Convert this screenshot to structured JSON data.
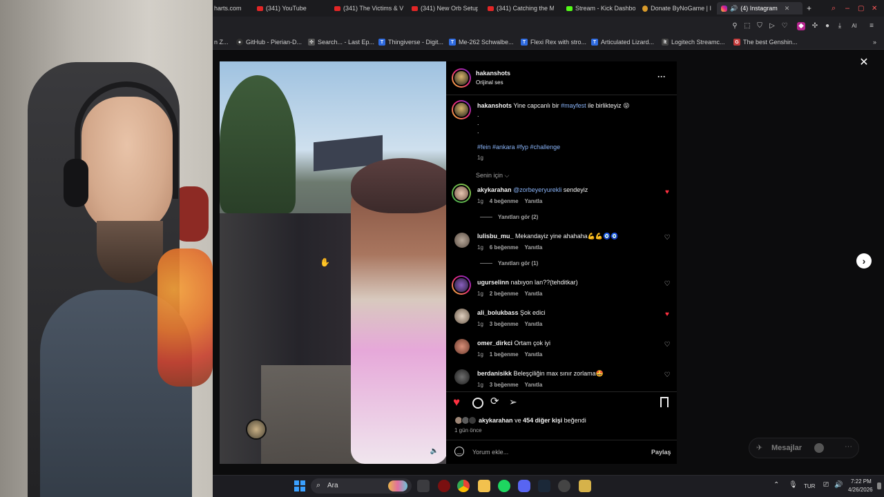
{
  "browser": {
    "tabs": [
      {
        "label": "harts.com",
        "icon": "none"
      },
      {
        "label": "(341) YouTube",
        "icon": "youtube"
      },
      {
        "label": "(341) The Victims & V",
        "icon": "youtube"
      },
      {
        "label": "(341) New Orb Setup!",
        "icon": "youtube"
      },
      {
        "label": "(341) Catching the M",
        "icon": "youtube"
      },
      {
        "label": "Stream - Kick Dashbo",
        "icon": "kick"
      },
      {
        "label": "Donate ByNoGame | I",
        "icon": "donate"
      },
      {
        "label": "(4) Instagram",
        "icon": "instagram",
        "active": true
      }
    ],
    "new_tab": "+",
    "toolbar_ai": "AI",
    "bookmarks": [
      {
        "label": "n Z...",
        "icon": "none"
      },
      {
        "label": "GitHub - Pierian-D...",
        "icon": "github"
      },
      {
        "label": "Search... - Last Ep...",
        "icon": "generic"
      },
      {
        "label": "Thingiverse - Digit...",
        "icon": "T"
      },
      {
        "label": "Me-262 Schwalbe...",
        "icon": "T"
      },
      {
        "label": "Flexi Rex with stro...",
        "icon": "T"
      },
      {
        "label": "Articulated Lizard...",
        "icon": "T"
      },
      {
        "label": "Logitech Streamc...",
        "icon": "logitech"
      },
      {
        "label": "The best Genshin...",
        "icon": "genshin"
      }
    ]
  },
  "post": {
    "author": "hakanshots",
    "audio": "Orijinal ses",
    "caption_user": "hakanshots",
    "caption_text_1": "Yine capcanlı bir",
    "caption_hashtag": "#mayfest",
    "caption_text_2": "ile birlikteyiz 😜",
    "caption_dots": [
      ".",
      ".",
      "."
    ],
    "caption_tags": "#fein #ankara #fyp #challenge",
    "caption_age": "1g",
    "sort_label": "Senin için",
    "likes_text_user": "akykarahan",
    "likes_text_rest": "ve",
    "likes_text_count": "454 diğer kişi",
    "likes_text_end": "beğendi",
    "post_time": "1 gün önce",
    "comment_placeholder": "Yorum ekle...",
    "share_label": "Paylaş",
    "more": "···"
  },
  "comments": [
    {
      "user": "akykarahan",
      "mention": "@zorbeyeryurekli",
      "text": "sendeyiz",
      "age": "1g",
      "likes": "4 beğenme",
      "reply": "Yanıtla",
      "liked": true,
      "replies": "Yanıtları gör (2)"
    },
    {
      "user": "lulisbu_mu_",
      "mention": "",
      "text": "Mekandayiz yine ahahaha💪💪🧿🧿",
      "age": "1g",
      "likes": "6 beğenme",
      "reply": "Yanıtla",
      "liked": false,
      "replies": "Yanıtları gör (1)"
    },
    {
      "user": "ugurselinn",
      "mention": "",
      "text": "nabıyon lan??(tehditkar)",
      "age": "1g",
      "likes": "2 beğenme",
      "reply": "Yanıtla",
      "liked": false,
      "replies": ""
    },
    {
      "user": "ali_bolukbass",
      "mention": "",
      "text": "Şok edici",
      "age": "1g",
      "likes": "3 beğenme",
      "reply": "Yanıtla",
      "liked": true,
      "replies": ""
    },
    {
      "user": "omer_dirkci",
      "mention": "",
      "text": "Ortam çok iyi",
      "age": "1g",
      "likes": "1 beğenme",
      "reply": "Yanıtla",
      "liked": false,
      "replies": ""
    },
    {
      "user": "berdanisikk",
      "mention": "",
      "text": "Beleşçiliğin max sınır zorlama🤩",
      "age": "1g",
      "likes": "3 beğenme",
      "reply": "Yanıtla",
      "liked": false,
      "replies": ""
    }
  ],
  "messages": {
    "label": "Mesajlar"
  },
  "taskbar": {
    "search_label": "Ara",
    "language": "TUR",
    "time": "7:22 PM",
    "date": "4/26/2026"
  },
  "colors": {
    "like_red": "#ff3040",
    "link_blue": "#8ab4f8",
    "panel_bg": "#000000"
  }
}
